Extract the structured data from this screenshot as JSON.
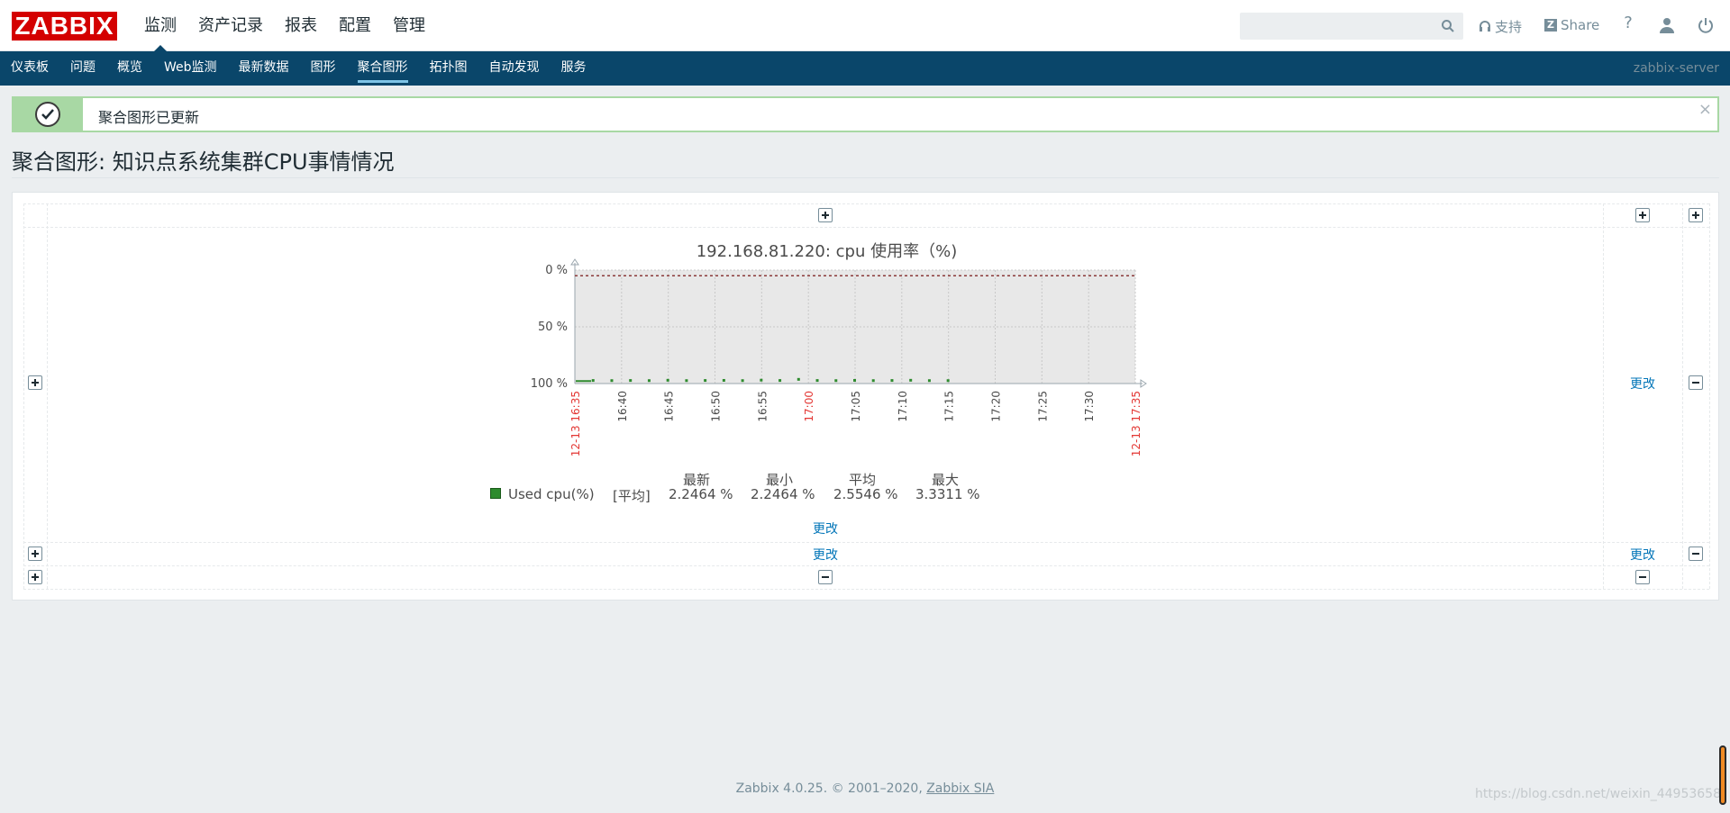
{
  "header": {
    "logo": "ZABBIX",
    "nav": [
      {
        "label": "监测",
        "active": true
      },
      {
        "label": "资产记录",
        "active": false
      },
      {
        "label": "报表",
        "active": false
      },
      {
        "label": "配置",
        "active": false
      },
      {
        "label": "管理",
        "active": false
      }
    ],
    "search_placeholder": "",
    "support_label": "支持",
    "share_label": "Share",
    "help_icon": "question-icon",
    "profile_icon": "user-icon",
    "logout_icon": "power-icon"
  },
  "subnav": {
    "items": [
      {
        "label": "仪表板",
        "active": false
      },
      {
        "label": "问题",
        "active": false
      },
      {
        "label": "概览",
        "active": false
      },
      {
        "label": "Web监测",
        "active": false
      },
      {
        "label": "最新数据",
        "active": false
      },
      {
        "label": "图形",
        "active": false
      },
      {
        "label": "聚合图形",
        "active": true
      },
      {
        "label": "拓扑图",
        "active": false
      },
      {
        "label": "自动发现",
        "active": false
      },
      {
        "label": "服务",
        "active": false
      }
    ],
    "server": "zabbix-server"
  },
  "message": {
    "text": "聚合图形已更新",
    "close": "×"
  },
  "page_title": "聚合图形: 知识点系统集群CPU事情情况",
  "screen": {
    "change_label": "更改"
  },
  "chart_data": {
    "type": "line",
    "title": "192.168.81.220: cpu 使用率（%)",
    "y_ticks": [
      "100 %",
      "50 %",
      "0 %"
    ],
    "ylim": [
      0,
      100
    ],
    "x_ticks": [
      "12-13 16:35",
      "16:40",
      "16:45",
      "16:50",
      "16:55",
      "17:00",
      "17:05",
      "17:10",
      "17:15",
      "17:20",
      "17:25",
      "17:30",
      "12-13 17:35"
    ],
    "x_tick_red": [
      true,
      false,
      false,
      false,
      false,
      true,
      false,
      false,
      false,
      false,
      false,
      false,
      true
    ],
    "threshold": 95,
    "series": [
      {
        "name": "Used cpu(%)",
        "color": "#2e8b2e",
        "x": [
          "16:37",
          "16:39",
          "16:41",
          "16:43",
          "16:45",
          "16:47",
          "16:49",
          "16:51",
          "16:53",
          "16:55",
          "16:57",
          "16:59",
          "17:01",
          "17:03",
          "17:05",
          "17:07",
          "17:09",
          "17:11",
          "17:13",
          "17:15"
        ],
        "values": [
          2.3,
          2.2,
          2.3,
          2.2,
          2.5,
          2.2,
          2.3,
          2.4,
          2.2,
          2.6,
          2.3,
          3.3,
          2.3,
          2.2,
          2.4,
          2.2,
          2.3,
          2.5,
          2.2,
          2.2
        ]
      }
    ],
    "legend": {
      "headers": [
        "最新",
        "最小",
        "平均",
        "最大"
      ],
      "row": {
        "name": "Used cpu(%)",
        "func": "[平均]",
        "last": "2.2464 %",
        "min": "2.2464 %",
        "avg": "2.5546 %",
        "max": "3.3311 %"
      }
    }
  },
  "footer": {
    "text": "Zabbix 4.0.25. © 2001–2020,",
    "link": "Zabbix SIA"
  },
  "watermark": "https://blog.csdn.net/weixin_44953658"
}
